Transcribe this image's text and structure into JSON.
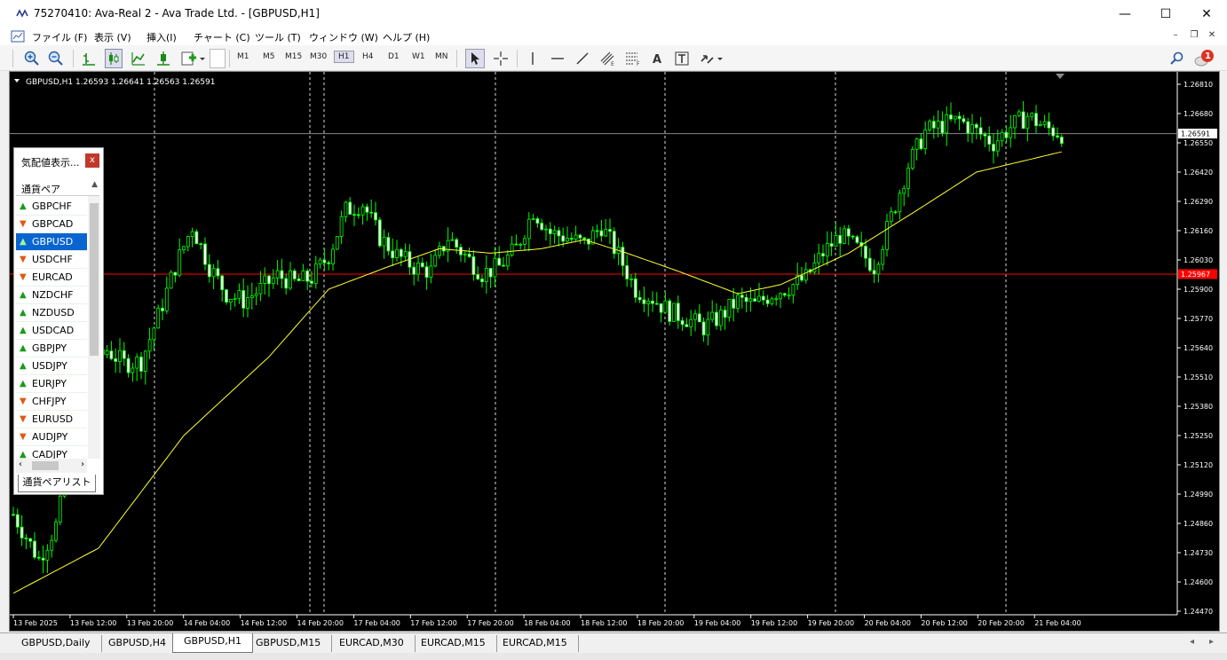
{
  "window": {
    "title": "75270410: Ava-Real 2 - Ava Trade Ltd. - [GBPUSD,H1]",
    "minimize": "—",
    "maximize": "☐",
    "close": "✕"
  },
  "menu": [
    {
      "label": "ファイル (F)"
    },
    {
      "label": "表示 (V)"
    },
    {
      "label": "挿入(I)"
    },
    {
      "label": "チャート (C)"
    },
    {
      "label": "ツール (T)"
    },
    {
      "label": "ウィンドウ (W)"
    },
    {
      "label": "ヘルプ (H)"
    }
  ],
  "toolbar": {
    "timeframes": [
      "M1",
      "M5",
      "M15",
      "M30",
      "H1",
      "H4",
      "D1",
      "W1",
      "MN"
    ],
    "active_timeframe": "H1",
    "notification_count": "1"
  },
  "chart": {
    "header": "GBPUSD,H1  1.26593 1.26641 1.26563 1.26591",
    "current_price_label": "1.26591",
    "red_line_label": "1.25967",
    "colors": {
      "background": "#000000",
      "candle": "#00ff00",
      "bull_body": "#000000",
      "bear_body": "#ffffff",
      "ma": "#ffff33",
      "red_line": "#ff0000",
      "grid": "#ffffff"
    }
  },
  "chart_data": {
    "type": "candlestick",
    "symbol": "GBPUSD",
    "timeframe": "H1",
    "ylim": [
      1.2447,
      1.2681
    ],
    "y_ticks": [
      1.2681,
      1.2668,
      1.2655,
      1.2642,
      1.2629,
      1.2616,
      1.2603,
      1.259,
      1.2577,
      1.2564,
      1.2551,
      1.2538,
      1.2525,
      1.2512,
      1.2499,
      1.2486,
      1.2473,
      1.246,
      1.2447
    ],
    "x_ticks": [
      "13 Feb 2025",
      "13 Feb 12:00",
      "13 Feb 20:00",
      "14 Feb 04:00",
      "14 Feb 12:00",
      "14 Feb 20:00",
      "17 Feb 04:00",
      "17 Feb 12:00",
      "17 Feb 20:00",
      "18 Feb 04:00",
      "18 Feb 12:00",
      "18 Feb 20:00",
      "19 Feb 04:00",
      "19 Feb 12:00",
      "19 Feb 20:00",
      "20 Feb 04:00",
      "20 Feb 12:00",
      "20 Feb 20:00",
      "21 Feb 04:00"
    ],
    "current_price": 1.26591,
    "horizontal_line": 1.25967,
    "close_path": [
      [
        0,
        1.249
      ],
      [
        6,
        1.247
      ],
      [
        10,
        1.2485
      ],
      [
        14,
        1.252
      ],
      [
        18,
        1.2555
      ],
      [
        22,
        1.2563
      ],
      [
        26,
        1.2557
      ],
      [
        30,
        1.2558
      ],
      [
        34,
        1.2578
      ],
      [
        38,
        1.26
      ],
      [
        42,
        1.2618
      ],
      [
        46,
        1.26
      ],
      [
        50,
        1.2588
      ],
      [
        54,
        1.2585
      ],
      [
        58,
        1.259
      ],
      [
        62,
        1.2596
      ],
      [
        66,
        1.2593
      ],
      [
        70,
        1.2595
      ],
      [
        74,
        1.2605
      ],
      [
        78,
        1.2625
      ],
      [
        82,
        1.2628
      ],
      [
        86,
        1.2613
      ],
      [
        90,
        1.2605
      ],
      [
        94,
        1.26
      ],
      [
        98,
        1.2598
      ],
      [
        102,
        1.2613
      ],
      [
        106,
        1.2605
      ],
      [
        110,
        1.2597
      ],
      [
        114,
        1.26
      ],
      [
        118,
        1.2608
      ],
      [
        122,
        1.2625
      ],
      [
        126,
        1.2615
      ],
      [
        130,
        1.2613
      ],
      [
        134,
        1.261
      ],
      [
        138,
        1.2618
      ],
      [
        142,
        1.2605
      ],
      [
        146,
        1.259
      ],
      [
        150,
        1.2586
      ],
      [
        154,
        1.258
      ],
      [
        158,
        1.2577
      ],
      [
        162,
        1.2573
      ],
      [
        166,
        1.2578
      ],
      [
        170,
        1.2585
      ],
      [
        174,
        1.2583
      ],
      [
        178,
        1.2588
      ],
      [
        182,
        1.2591
      ],
      [
        186,
        1.2595
      ],
      [
        190,
        1.2606
      ],
      [
        194,
        1.2614
      ],
      [
        198,
        1.2608
      ],
      [
        202,
        1.26
      ],
      [
        206,
        1.2622
      ],
      [
        210,
        1.2645
      ],
      [
        214,
        1.266
      ],
      [
        218,
        1.2663
      ],
      [
        222,
        1.2665
      ],
      [
        226,
        1.266
      ],
      [
        230,
        1.2655
      ],
      [
        234,
        1.2662
      ],
      [
        238,
        1.2667
      ],
      [
        242,
        1.2662
      ],
      [
        246,
        1.2659
      ]
    ],
    "ma_path": [
      [
        0,
        1.2455
      ],
      [
        20,
        1.2475
      ],
      [
        40,
        1.2525
      ],
      [
        60,
        1.256
      ],
      [
        74,
        1.259
      ],
      [
        88,
        1.26
      ],
      [
        100,
        1.2608
      ],
      [
        112,
        1.2606
      ],
      [
        124,
        1.2608
      ],
      [
        134,
        1.2612
      ],
      [
        144,
        1.2606
      ],
      [
        156,
        1.2598
      ],
      [
        170,
        1.2588
      ],
      [
        180,
        1.2592
      ],
      [
        196,
        1.2606
      ],
      [
        212,
        1.2625
      ],
      [
        226,
        1.2642
      ],
      [
        246,
        1.2651
      ]
    ]
  },
  "market_watch": {
    "title": "気配値表示...",
    "column": "通貨ペア",
    "tab": "通貨ペアリスト",
    "close_label": "x",
    "symbols": [
      {
        "name": "GBPCHF",
        "dir": "up"
      },
      {
        "name": "GBPCAD",
        "dir": "down"
      },
      {
        "name": "GBPUSD",
        "dir": "up",
        "selected": true
      },
      {
        "name": "USDCHF",
        "dir": "down"
      },
      {
        "name": "EURCAD",
        "dir": "down"
      },
      {
        "name": "NZDCHF",
        "dir": "up"
      },
      {
        "name": "NZDUSD",
        "dir": "up"
      },
      {
        "name": "USDCAD",
        "dir": "up"
      },
      {
        "name": "GBPJPY",
        "dir": "up"
      },
      {
        "name": "USDJPY",
        "dir": "up"
      },
      {
        "name": "EURJPY",
        "dir": "up"
      },
      {
        "name": "CHFJPY",
        "dir": "down"
      },
      {
        "name": "EURUSD",
        "dir": "down"
      },
      {
        "name": "AUDJPY",
        "dir": "down"
      },
      {
        "name": "CADJPY",
        "dir": "up"
      }
    ]
  },
  "chart_tabs": [
    "GBPUSD,Daily",
    "GBPUSD,H4",
    "GBPUSD,H1",
    "GBPUSD,M15",
    "EURCAD,M30",
    "EURCAD,M15",
    "EURCAD,M15"
  ],
  "active_chart_tab": "GBPUSD,H1"
}
